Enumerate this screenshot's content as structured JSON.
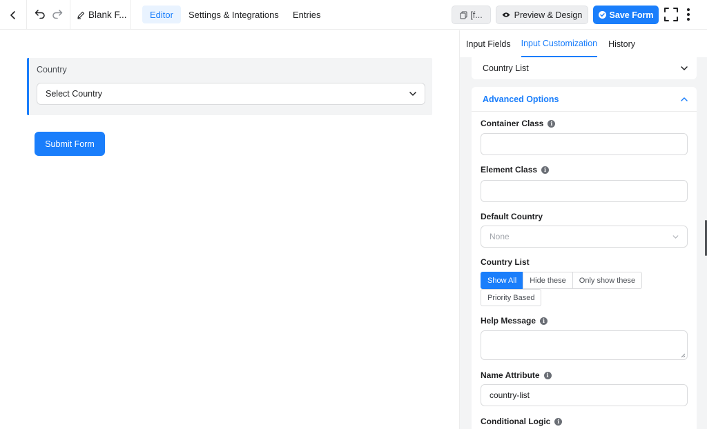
{
  "topbar": {
    "form_title": "Blank F...",
    "tabs": [
      {
        "label": "Editor",
        "active": true
      },
      {
        "label": "Settings & Integrations",
        "active": false
      },
      {
        "label": "Entries",
        "active": false
      }
    ],
    "shortcode_label": "[f...",
    "preview_label": "Preview & Design",
    "save_label": "Save Form"
  },
  "canvas": {
    "field_label": "Country",
    "select_value": "Select Country",
    "submit_label": "Submit Form"
  },
  "panel": {
    "tabs": [
      {
        "label": "Input Fields",
        "active": false
      },
      {
        "label": "Input Customization",
        "active": true
      },
      {
        "label": "History",
        "active": false
      }
    ],
    "country_list_section": "Country List",
    "advanced_title": "Advanced Options",
    "container_class_label": "Container Class",
    "container_class_value": "",
    "element_class_label": "Element Class",
    "element_class_value": "",
    "default_country_label": "Default Country",
    "default_country_value": "None",
    "country_list_label": "Country List",
    "country_list_options": [
      "Show All",
      "Hide these",
      "Only show these",
      "Priority Based"
    ],
    "country_list_selected": "Show All",
    "help_message_label": "Help Message",
    "name_attribute_label": "Name Attribute",
    "name_attribute_value": "country-list",
    "conditional_logic_label": "Conditional Logic"
  },
  "colors": {
    "accent": "#1a7efb",
    "panel_bg": "#f3f4f5",
    "border": "#dadbdd"
  }
}
